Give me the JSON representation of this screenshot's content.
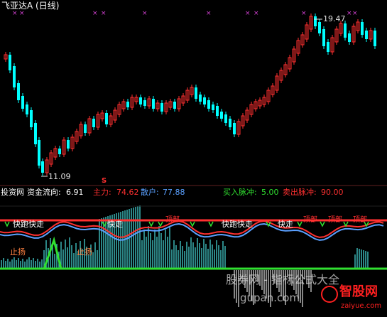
{
  "title": "飞亚达A (日线)",
  "upper": {
    "high_label": "19.47",
    "low_label": "11.09",
    "signal_marker": "S"
  },
  "indicator_header": {
    "source": "投资网",
    "fund_flow_label": "资金流向:",
    "fund_flow_value": "6.91",
    "main_label": "主力:",
    "main_value": "74.62",
    "retail_label": "散户:",
    "retail_value": "77.88",
    "buy_pulse_label": "买入脉冲:",
    "buy_pulse_value": "5.00",
    "sell_pulse_label": "卖出脉冲:",
    "sell_pulse_value": "90.00"
  },
  "signal_labels": {
    "fast_run": "快走",
    "sell_run": "快跑快走",
    "stop_loss": "止扬",
    "top": "顶部"
  },
  "watermark": {
    "text1": "股券网 - 指标公式大全",
    "text2": "gupan.com",
    "brand": "智股网",
    "brand_url": "zaiyue.com"
  },
  "colors": {
    "up": "#ff3030",
    "down": "#00ffff",
    "main_line": "#ff3030",
    "retail_line": "#5aa0ff",
    "bars": "#40c0c0",
    "green": "#30e030",
    "yellow": "#ffff40"
  }
}
